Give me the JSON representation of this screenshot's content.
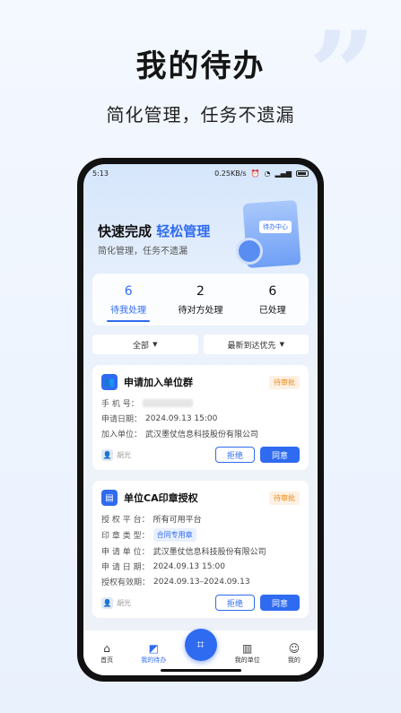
{
  "promo": {
    "title": "我的待办",
    "subtitle": "简化管理，任务不遗漏",
    "quote_glyph": "”"
  },
  "status_bar": {
    "time": "5:13",
    "network_speed": "0.25KB/s",
    "battery": "100"
  },
  "banner": {
    "title_plain": "快速完成",
    "title_accent": "轻松管理",
    "subtitle": "简化管理，任务不遗漏",
    "illustration_tag": "待办中心"
  },
  "tabs": [
    {
      "count": "6",
      "label": "待我处理",
      "active": true
    },
    {
      "count": "2",
      "label": "待对方处理",
      "active": false
    },
    {
      "count": "6",
      "label": "已处理",
      "active": false
    }
  ],
  "filters": {
    "scope": "全部",
    "sort": "最新到达优先"
  },
  "cards": [
    {
      "title": "申请加入单位群",
      "badge": "待审批",
      "icon": "user-group-icon",
      "rows": [
        {
          "key": "手 机 号：",
          "value": ""
        },
        {
          "key": "申请日期：",
          "value": "2024.09.13 15:00"
        },
        {
          "key": "加入单位：",
          "value": "武汉墨仗信息科技股份有限公司"
        }
      ],
      "user": "胡光",
      "reject": "拒绝",
      "agree": "同意"
    },
    {
      "title": "单位CA印章授权",
      "badge": "待审批",
      "icon": "ca-seal-icon",
      "rows": [
        {
          "key": "授 权 平 台：",
          "value": "所有可用平台"
        },
        {
          "key": "印 章 类 型：",
          "value": "合同专用章"
        },
        {
          "key": "申 请 单 位：",
          "value": "武汉墨仗信息科技股份有限公司"
        },
        {
          "key": "申 请 日 期：",
          "value": "2024.09.13 15:00"
        },
        {
          "key": "授权有效期：",
          "value": "2024.09.13–2024.09.13"
        }
      ],
      "user": "胡光",
      "reject": "拒绝",
      "agree": "同意"
    }
  ],
  "nav": [
    {
      "label": "首页",
      "icon": "home-icon",
      "active": false
    },
    {
      "label": "我的待办",
      "icon": "todo-chart-icon",
      "active": true
    },
    {
      "label": "我的单位",
      "icon": "building-icon",
      "active": false
    },
    {
      "label": "我的",
      "icon": "profile-icon",
      "active": false
    }
  ],
  "colors": {
    "accent": "#2f6bf0",
    "pending": "#f08a1a"
  }
}
